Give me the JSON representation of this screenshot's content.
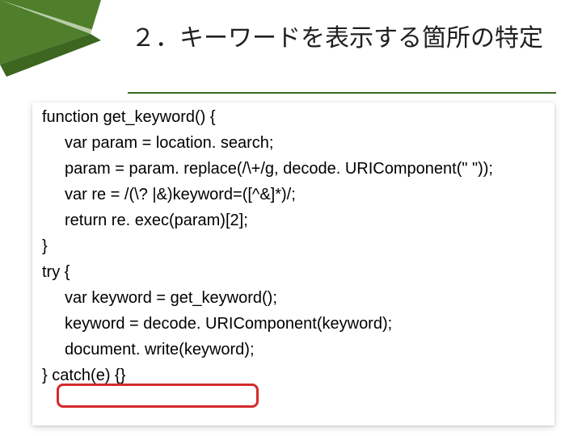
{
  "title": "２．キーワードを表示する箇所の特定",
  "code": {
    "l1": "function get_keyword() {",
    "l2": "var param = location. search;",
    "l3": "param = param. replace(/\\+/g, decode. URIComponent(\" \"));",
    "l4": "var re = /(\\? |&)keyword=([^&]*)/;",
    "l5": "return re. exec(param)[2];",
    "l6": "}",
    "l7": "try {",
    "l8": "var keyword = get_keyword();",
    "l9": "keyword = decode. URIComponent(keyword);",
    "l10": "document. write(keyword);",
    "l11": "} catch(e) {}"
  }
}
